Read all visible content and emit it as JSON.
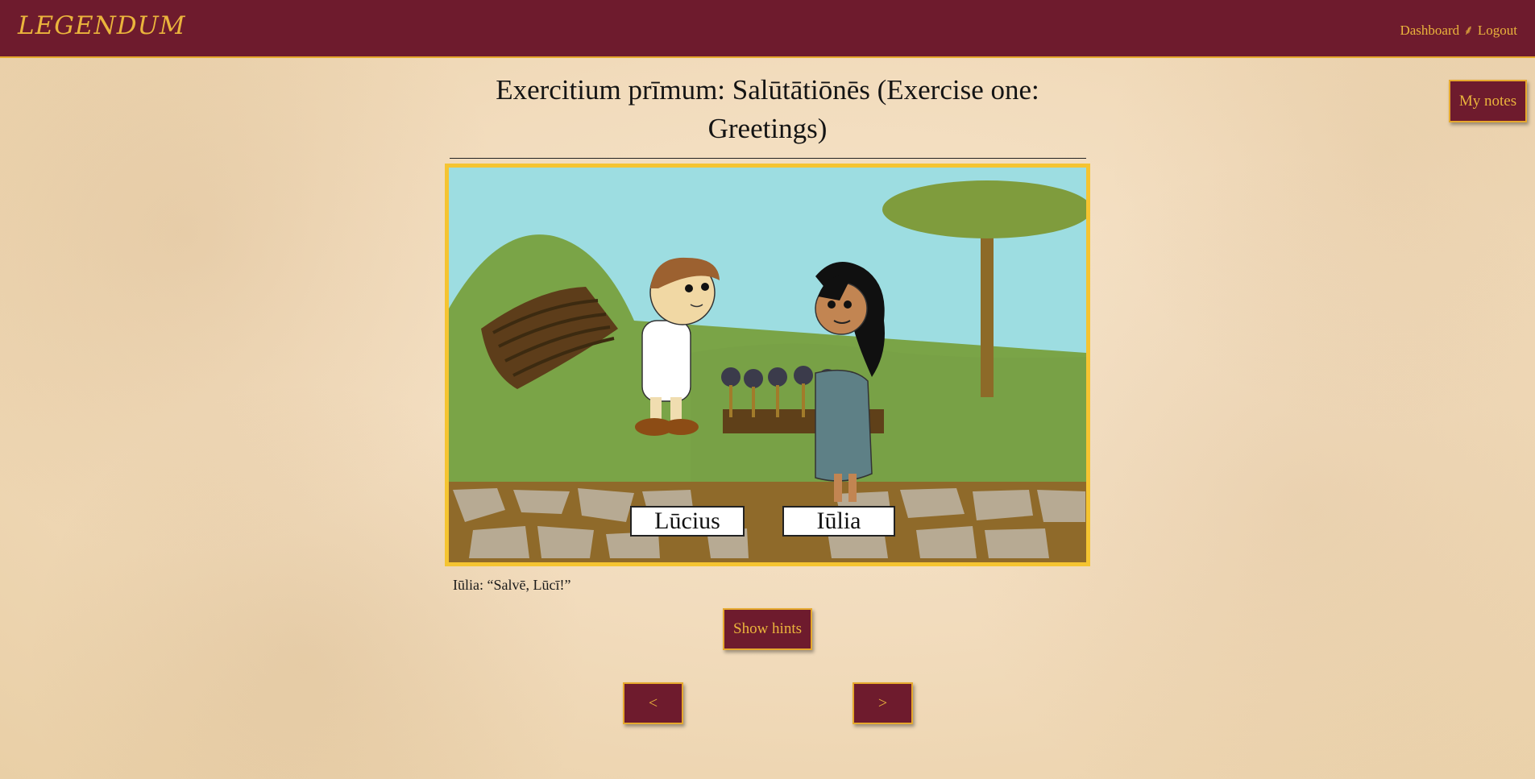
{
  "header": {
    "logo": "LEGENDUM",
    "nav": {
      "dashboard": "Dashboard",
      "separator": "⸙",
      "logout": "Logout"
    }
  },
  "notes_button": "My notes",
  "exercise": {
    "title": "Exercitium prīmum: Salūtātiōnēs (Exercise one: Greetings)",
    "scene_labels": [
      "Lūcius",
      "Iūlia"
    ],
    "caption": "Iūlia: “Salvē, Lūcī!”"
  },
  "hints_button": "Show hints",
  "pagination": {
    "prev": "<",
    "next": ">"
  },
  "colors": {
    "brand": "#6e1b2d",
    "accent": "#eab43c",
    "frame": "#f5c431"
  }
}
